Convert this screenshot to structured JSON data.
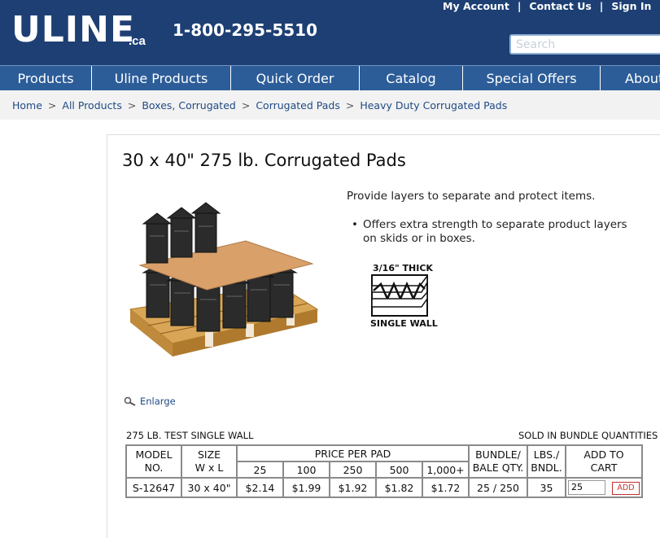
{
  "header": {
    "logo": "ULINE",
    "logo_suffix": ".ca",
    "phone": "1-800-295-5510",
    "links": [
      "My Account",
      "Contact Us",
      "Sign In"
    ],
    "search_placeholder": "Search"
  },
  "nav": {
    "items": [
      "Products",
      "Uline Products",
      "Quick Order",
      "Catalog",
      "Special Offers",
      "About"
    ]
  },
  "breadcrumb": [
    "Home",
    "All Products",
    "Boxes, Corrugated",
    "Corrugated Pads",
    "Heavy Duty Corrugated Pads"
  ],
  "product": {
    "title": "30 x 40\" 275 lb. Corrugated Pads",
    "description": "Provide layers to separate and protect items.",
    "bullet": "Offers extra strength to separate product layers on skids or in boxes.",
    "thickness": "3/16\" THICK",
    "wall": "SINGLE WALL",
    "enlarge": "Enlarge"
  },
  "table": {
    "title": "275 LB. TEST SINGLE WALL",
    "note": "SOLD IN BUNDLE QUANTITIES",
    "headers": {
      "model": [
        "MODEL",
        "NO."
      ],
      "size": [
        "SIZE",
        "W x L"
      ],
      "price": "PRICE PER PAD",
      "bundle": [
        "BUNDLE/",
        "BALE QTY."
      ],
      "lbs": [
        "LBS./",
        "BNDL."
      ],
      "cart": [
        "ADD TO",
        "CART"
      ]
    },
    "tiers": [
      "25",
      "100",
      "250",
      "500",
      "1,000+"
    ],
    "row": {
      "model": "S-12647",
      "size": "30 x 40\"",
      "prices": [
        "$2.14",
        "$1.99",
        "$1.92",
        "$1.82",
        "$1.72"
      ],
      "bundle": "25 / 250",
      "lbs": "35",
      "qty": "25",
      "add": "ADD"
    }
  }
}
